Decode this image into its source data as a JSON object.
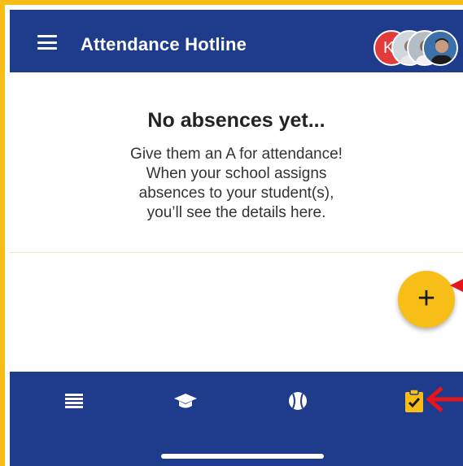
{
  "header": {
    "title": "Attendance Hotline",
    "menu_icon": "hamburger-menu-icon",
    "avatars": [
      {
        "initial": "K",
        "color": "#E23B3B"
      },
      {
        "initial": "",
        "icon": "student-photo"
      },
      {
        "initial": "",
        "icon": "student-photo"
      },
      {
        "initial": "",
        "icon": "student-photo"
      }
    ]
  },
  "empty_state": {
    "title": "No absences yet...",
    "lines": [
      "Give them an A for attendance!",
      "When your school assigns",
      "absences to your student(s),",
      "you’ll see the details here."
    ]
  },
  "fab": {
    "label": "+",
    "icon": "add-icon"
  },
  "bottom_nav": {
    "items": [
      {
        "icon": "list-icon",
        "active": false
      },
      {
        "icon": "graduation-cap-icon",
        "active": false
      },
      {
        "icon": "baseball-icon",
        "active": false
      },
      {
        "icon": "clipboard-check-icon",
        "active": true
      }
    ]
  },
  "colors": {
    "primary": "#1F3B8C",
    "accent": "#F7BE17",
    "annotation": "#E8141B"
  }
}
